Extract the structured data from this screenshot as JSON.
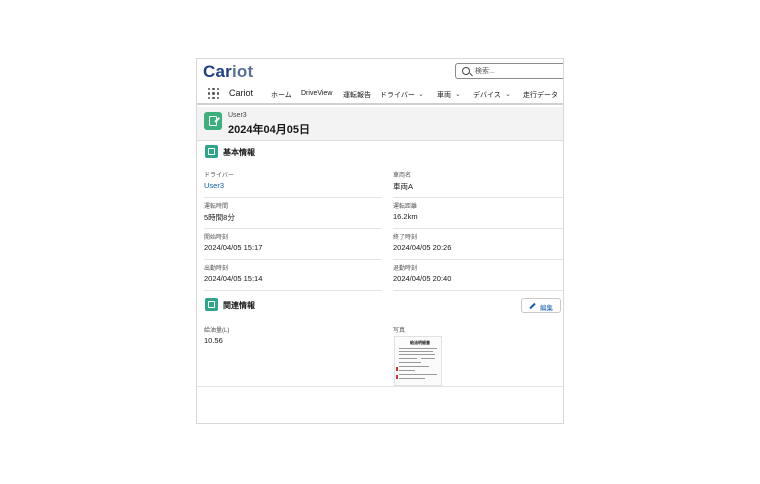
{
  "header": {
    "logo_part1": "Car",
    "logo_part2": "iot",
    "search_placeholder": "検索..."
  },
  "nav": {
    "app_name": "Cariot",
    "items": [
      {
        "label": "ホーム",
        "has_menu": false
      },
      {
        "label": "DriveView",
        "has_menu": false
      },
      {
        "label": "運転報告",
        "has_menu": false
      },
      {
        "label": "ドライバー",
        "has_menu": true
      },
      {
        "label": "車両",
        "has_menu": true
      },
      {
        "label": "デバイス",
        "has_menu": true
      },
      {
        "label": "走行データ",
        "has_menu": false
      }
    ]
  },
  "record": {
    "subtitle": "User3",
    "title": "2024年04月05日"
  },
  "sections": {
    "basic": {
      "title": "基本情報",
      "fields": {
        "driver": {
          "label": "ドライバー",
          "value": "User3"
        },
        "vehicle": {
          "label": "車両名",
          "value": "車両A"
        },
        "drive_time": {
          "label": "運転時間",
          "value": "5時間8分"
        },
        "distance": {
          "label": "運転距離",
          "value": "16.2km"
        },
        "start_time": {
          "label": "開始時刻",
          "value": "2024/04/05 15:17"
        },
        "end_time": {
          "label": "終了時刻",
          "value": "2024/04/05 20:26"
        },
        "clock_in": {
          "label": "出勤時刻",
          "value": "2024/04/05 15:14"
        },
        "clock_out": {
          "label": "退勤時刻",
          "value": "2024/04/05 20:40"
        }
      }
    },
    "related": {
      "title": "関連情報",
      "edit_label": "編集",
      "fields": {
        "fuel": {
          "label": "給油量(L)",
          "value": "10.56"
        },
        "photo": {
          "label": "写真",
          "receipt_title": "給油明細書"
        }
      }
    }
  },
  "colors": {
    "brand_dark": "#1f3f85",
    "link": "#0b5cab",
    "record_icon": "#3bb07c",
    "section_icon": "#2fa58a"
  }
}
